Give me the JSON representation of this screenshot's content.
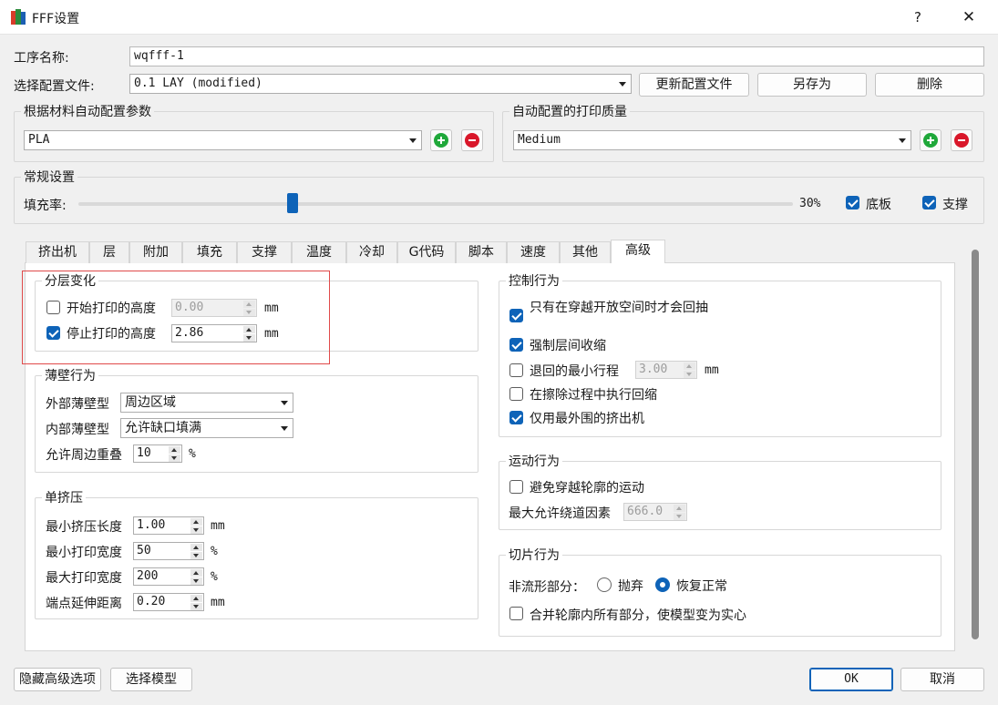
{
  "window": {
    "title": "FFF设置",
    "help": "?",
    "close": "✕"
  },
  "job": {
    "name_label": "工序名称:",
    "name_value": "wqfff-1"
  },
  "profile": {
    "label": "选择配置文件:",
    "value": "0.1 LAY (modified)",
    "update_btn": "更新配置文件",
    "save_as_btn": "另存为",
    "delete_btn": "删除"
  },
  "material": {
    "group_title": "根据材料自动配置参数",
    "value": "PLA"
  },
  "quality": {
    "group_title": "自动配置的打印质量",
    "value": "Medium"
  },
  "general": {
    "group_title": "常规设置",
    "infill_label": "填充率:",
    "infill_value": "30%",
    "infill_fraction": 0.3,
    "raft_label": "底板",
    "raft_checked": true,
    "support_label": "支撑",
    "support_checked": true
  },
  "tabs": [
    {
      "label": "挤出机"
    },
    {
      "label": "层"
    },
    {
      "label": "附加"
    },
    {
      "label": "填充"
    },
    {
      "label": "支撑"
    },
    {
      "label": "温度"
    },
    {
      "label": "冷却"
    },
    {
      "label": "G代码"
    },
    {
      "label": "脚本"
    },
    {
      "label": "速度"
    },
    {
      "label": "其他"
    },
    {
      "label": "高级",
      "active": true
    }
  ],
  "layer_change": {
    "title": "分层变化",
    "start_label": "开始打印的高度",
    "start_value": "0.00",
    "start_checked": false,
    "stop_label": "停止打印的高度",
    "stop_value": "2.86",
    "stop_checked": true,
    "unit": "mm"
  },
  "thin_wall": {
    "title": "薄壁行为",
    "outer_label": "外部薄壁型",
    "outer_value": "周边区域",
    "inner_label": "内部薄壁型",
    "inner_value": "允许缺口填满",
    "overlap_label": "允许周边重叠",
    "overlap_value": "10",
    "overlap_unit": "%"
  },
  "single_extrusion": {
    "title": "单挤压",
    "rows": [
      {
        "label": "最小挤压长度",
        "value": "1.00",
        "unit": "mm"
      },
      {
        "label": "最小打印宽度",
        "value": "50",
        "unit": "%"
      },
      {
        "label": "最大打印宽度",
        "value": "200",
        "unit": "%"
      },
      {
        "label": "端点延伸距离",
        "value": "0.20",
        "unit": "mm"
      }
    ]
  },
  "control": {
    "title": "控制行为",
    "items": [
      {
        "label": "只有在穿越开放空间时才会回抽",
        "checked": true
      },
      {
        "label": "强制层间收缩",
        "checked": true
      },
      {
        "label": "退回的最小行程",
        "checked": false,
        "value": "3.00",
        "unit": "mm"
      },
      {
        "label": "在擦除过程中执行回缩",
        "checked": false
      },
      {
        "label": "仅用最外围的挤出机",
        "checked": true
      }
    ]
  },
  "motion": {
    "title": "运动行为",
    "avoid_label": "避免穿越轮廓的运动",
    "avoid_checked": false,
    "detour_label": "最大允许绕道因素",
    "detour_value": "666.0"
  },
  "slicing": {
    "title": "切片行为",
    "nonmanifold_label": "非流形部分：",
    "discard_label": "抛弃",
    "restore_label": "恢复正常",
    "selected": "恢复正常",
    "merge_label": "合并轮廓内所有部分，使模型变为实心",
    "merge_checked": false
  },
  "footer": {
    "hide_adv": "隐藏高级选项",
    "select_model": "选择模型",
    "ok": "OK",
    "cancel": "取消"
  },
  "colors": {
    "accent": "#0e63b8",
    "add": "#1fa83a",
    "remove": "#d9172a",
    "highlight": "#e04a4a"
  }
}
